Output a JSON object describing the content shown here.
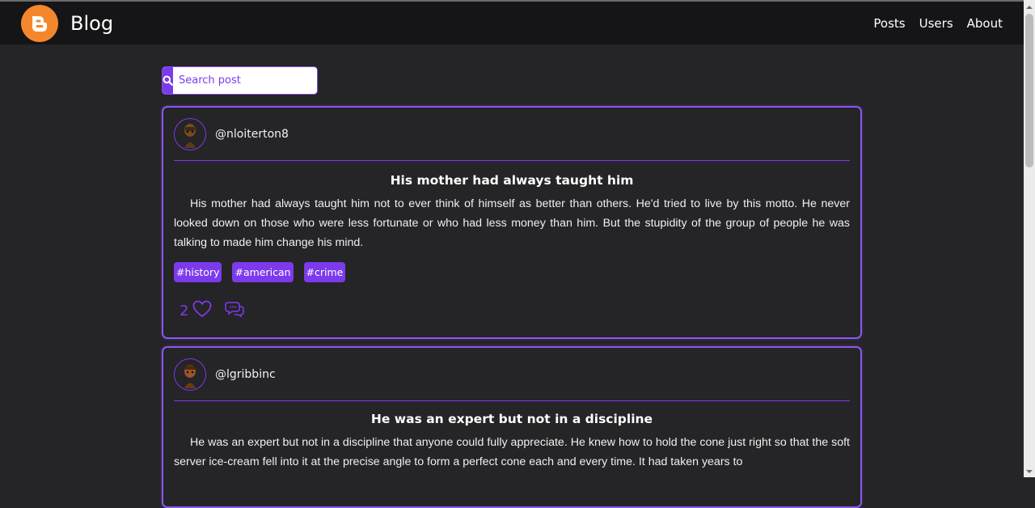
{
  "navbar": {
    "brand": "Blog",
    "links": [
      "Posts",
      "Users",
      "About"
    ]
  },
  "search": {
    "placeholder": "Search post"
  },
  "posts": [
    {
      "username": "@nloiterton8",
      "title": "His mother had always taught him",
      "body": "His mother had always taught him not to ever think of himself as better than others. He'd tried to live by this motto. He never looked down on those who were less fortunate or who had less money than him. But the stupidity of the group of people he was talking to made him change his mind.",
      "tags": [
        "#history",
        "#american",
        "#crime"
      ],
      "likes": "2"
    },
    {
      "username": "@lgribbinc",
      "title": "He was an expert but not in a discipline",
      "body": "He was an expert but not in a discipline that anyone could fully appreciate. He knew how to hold the cone just right so that the soft server ice-cream fell into it at the precise angle to form a perfect cone each and every time. It had taken years to"
    }
  ],
  "colors": {
    "accent": "#7c3aed",
    "background": "#252426",
    "navbar": "#151416",
    "logo": "#f4872c"
  }
}
